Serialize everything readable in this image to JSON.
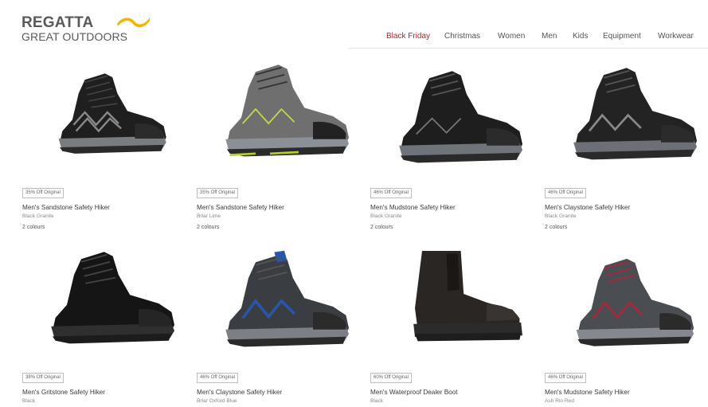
{
  "logo": {
    "brand": "REGATTA",
    "sub": "GREAT OUTDOORS",
    "accent": "#f2b600"
  },
  "nav": [
    {
      "label": "Black Friday",
      "active": true
    },
    {
      "label": "Christmas"
    },
    {
      "label": "Women"
    },
    {
      "label": "Men"
    },
    {
      "label": "Kids"
    },
    {
      "label": "Equipment"
    },
    {
      "label": "Workwear"
    }
  ],
  "products": [
    {
      "badge": "35% Off Original",
      "name": "Men's Sandstone Safety Hiker",
      "colour": "Black Granite",
      "colours": "2 colours"
    },
    {
      "badge": "35% Off Original",
      "name": "Men's Sandstone Safety Hiker",
      "colour": "Briar Lime",
      "colours": "2 colours"
    },
    {
      "badge": "46% Off Original",
      "name": "Men's Mudstone Safety Hiker",
      "colour": "Black Granite",
      "colours": "2 colours"
    },
    {
      "badge": "46% Off Original",
      "name": "Men's Claystone Safety Hiker",
      "colour": "Black Granite",
      "colours": "2 colours"
    },
    {
      "badge": "38% Off Original",
      "name": "Men's Gritstone Safety Hiker",
      "colour": "Black"
    },
    {
      "badge": "46% Off Original",
      "name": "Men's Claystone Safety Hiker",
      "colour": "Briar Oxford Blue"
    },
    {
      "badge": "60% Off Original",
      "name": "Men's Waterproof Dealer Boot",
      "colour": "Black"
    },
    {
      "badge": "46% Off Original",
      "name": "Men's Mudstone Safety Hiker",
      "colour": "Ash Rio Red"
    }
  ]
}
